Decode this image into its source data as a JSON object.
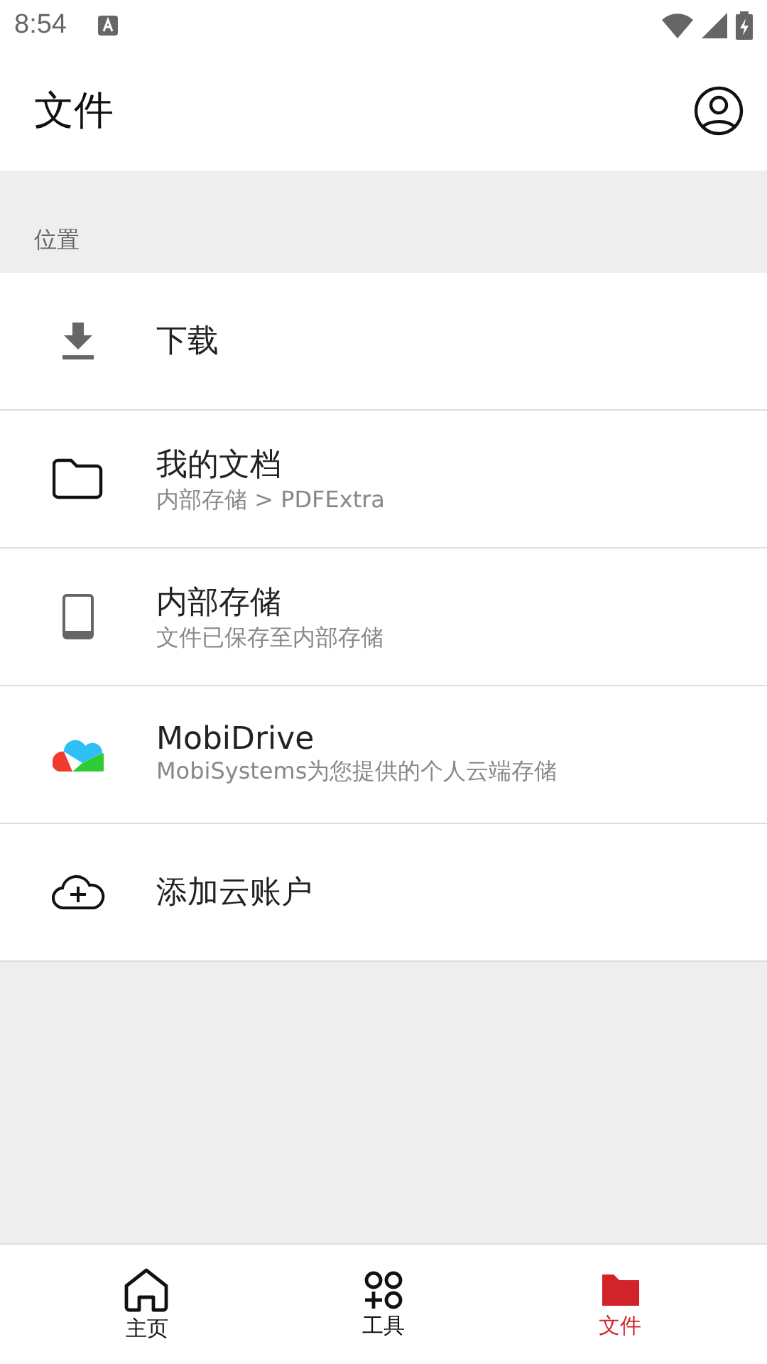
{
  "status_bar": {
    "time": "8:54"
  },
  "app_bar": {
    "title": "文件"
  },
  "section": {
    "label": "位置"
  },
  "locations": [
    {
      "title": "下载"
    },
    {
      "title": "我的文档",
      "subtitle": "内部存储 > PDFExtra"
    },
    {
      "title": "内部存储",
      "subtitle": "文件已保存至内部存储"
    },
    {
      "title": "MobiDrive",
      "subtitle": "MobiSystems为您提供的个人云端存储"
    },
    {
      "title": "添加云账户"
    }
  ],
  "bottom_nav": [
    {
      "label": "主页",
      "selected": false
    },
    {
      "label": "工具",
      "selected": false
    },
    {
      "label": "文件",
      "selected": true
    }
  ]
}
